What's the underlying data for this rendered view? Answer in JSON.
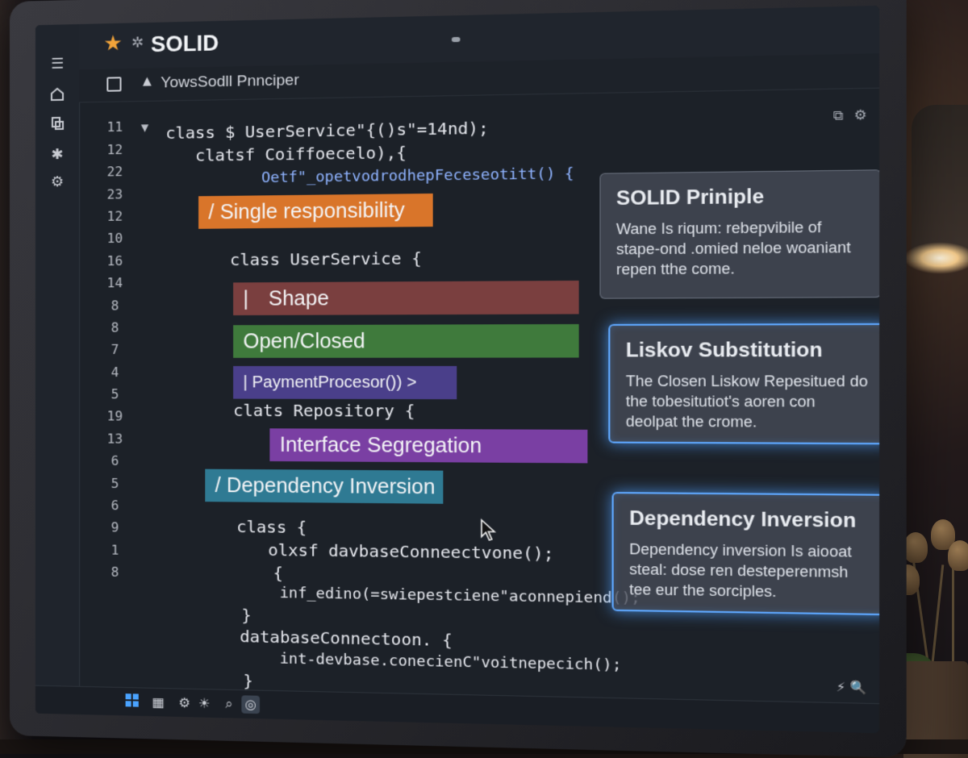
{
  "window": {
    "title": "SOLID"
  },
  "tab": {
    "path": "YowsSodll Pnnciper"
  },
  "line_numbers": [
    "11",
    "12",
    "22",
    "23",
    "12",
    "10",
    "16",
    "14",
    "8",
    "8",
    "7",
    "4",
    "5",
    "19",
    "13",
    "6",
    "5",
    "6",
    "9",
    "1",
    "8"
  ],
  "code": {
    "l1": "class $ UserService\"{()s\"=14nd);",
    "l2": "clatsf Coiffoecelo),{",
    "l3": "Oetf\"_opetvodrodhepFeceseotitt() {",
    "l4": "class UserService {",
    "l5": "clats Repository {",
    "l6": "class {",
    "l7": "olxsf davbaseConneectvone();",
    "l8": "{",
    "l9": "inf_edino(=swiepestciene\"aconnepiend();",
    "l10": "}",
    "l11": "databaseConnectoon. {",
    "l12": "int-devbase.conecienC\"voitnepecich();",
    "l13": "}"
  },
  "highlights": {
    "single": "/ Single responsibility",
    "shape_slash": "|",
    "shape": "Shape",
    "open_closed": "Open/Closed",
    "payment": "|   PaymentProcesor()) >",
    "interface": "Interface Segregation",
    "dependency": "/ Dependency Inversion"
  },
  "cards": [
    {
      "title": "SOLID Priniple",
      "body": "Wane Is riqum: rebepvibile of stape-ond .omied neloe woaniant repen tthe come."
    },
    {
      "title": "Liskov Substitution",
      "body": "The Closen Liskow Repesitued do the tobesitutiot's aoren con deolpat the crome."
    },
    {
      "title": "Dependency Inversion",
      "body": "Dependency inversion Is aiooat steal: dose ren desteperenmsh tee eur the sorciples."
    }
  ],
  "colors": {
    "single": "#d9752a",
    "shape": "#7a3f3f",
    "open_closed": "#3f7a3c",
    "payment": "#4a3f8a",
    "interface": "#7a3fa3",
    "dependency": "#2f7a93",
    "glow": "#5fa8ff"
  },
  "icons": {
    "activitybar": [
      "menu-icon",
      "home-icon",
      "files-icon",
      "extensions-icon",
      "settings-icon"
    ],
    "statusbar": [
      "windows-icon",
      "grid-icon",
      "gear-icon",
      "search-icon",
      "record-icon"
    ]
  }
}
